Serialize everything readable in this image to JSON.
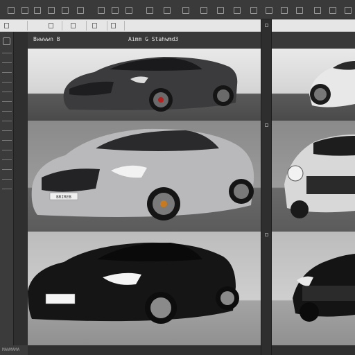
{
  "canvas": {
    "header_left": "Bwwwwn B",
    "header_center": "Aimm G Stahwmd3"
  },
  "status": {
    "bottom_label": "MAWMAMA"
  },
  "plates": {
    "silver_front": "BRIREB",
    "black_front": ""
  },
  "colors": {
    "toolbar_bg": "#3a3a3a",
    "panel_bg": "#2f2f2f",
    "light_strip": "#e6e6e6"
  }
}
